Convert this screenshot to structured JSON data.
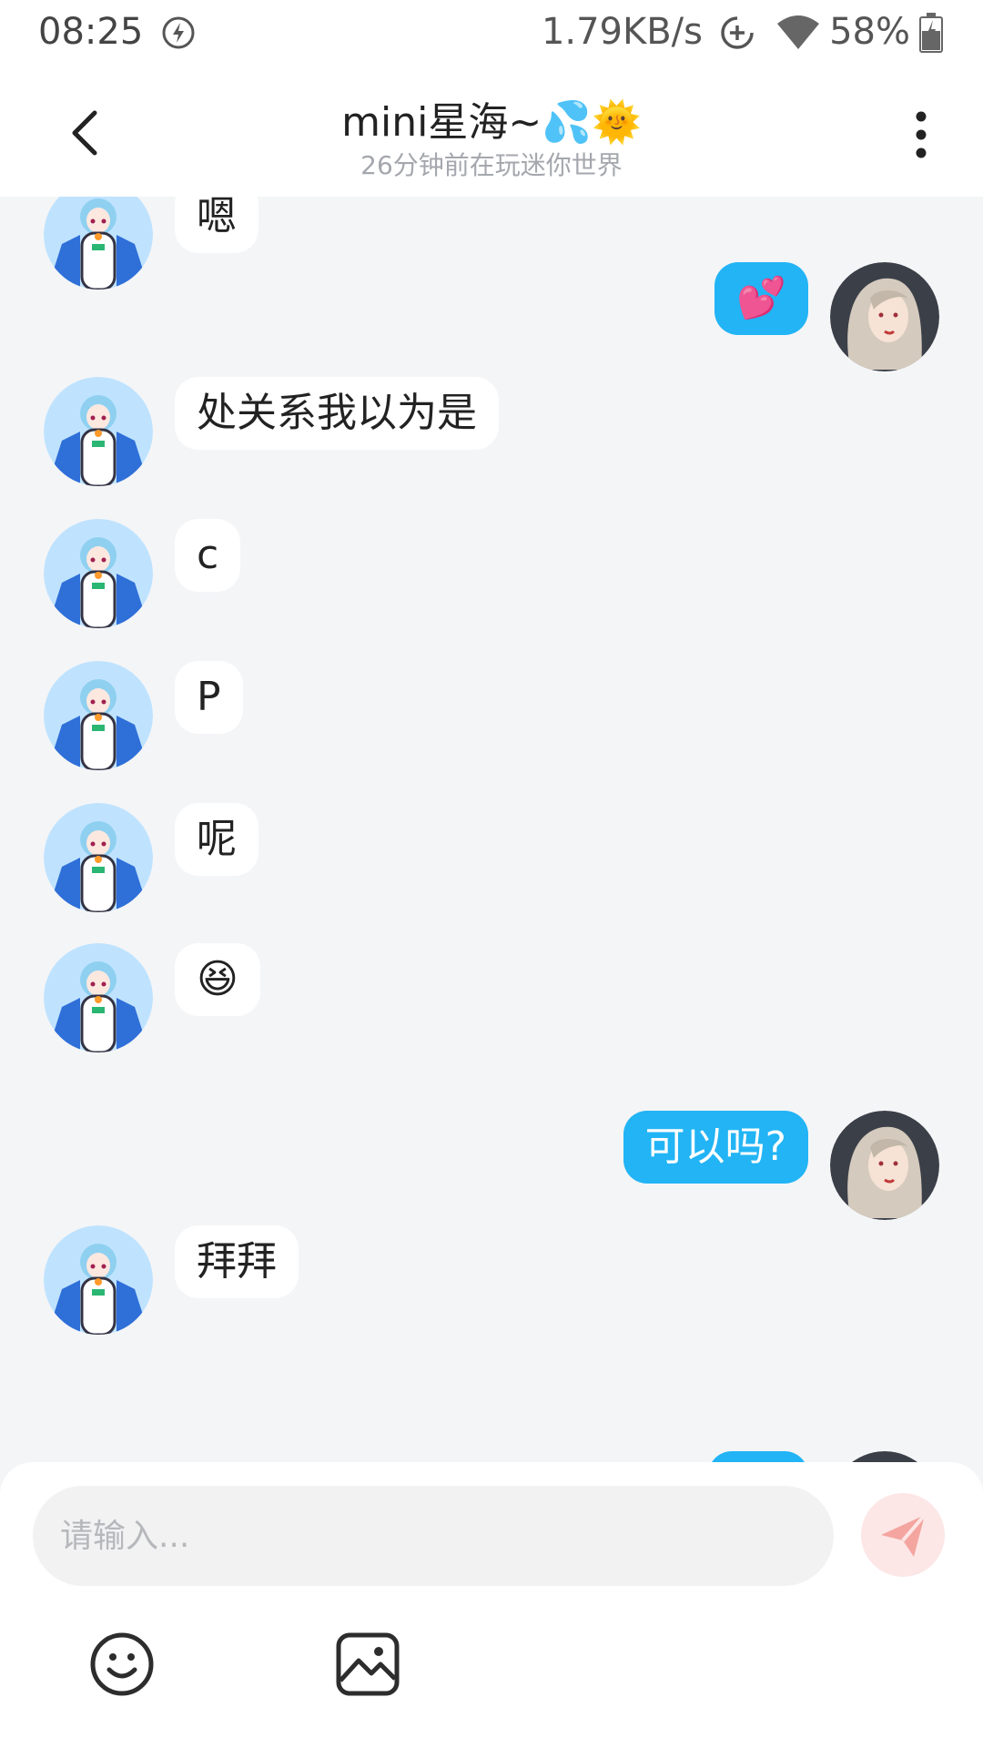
{
  "status_bar": {
    "time": "08:25",
    "network_speed": "1.79KB/s",
    "battery": "58%"
  },
  "header": {
    "title": "mini星海~💦🌞",
    "subtitle": "26分钟前在玩迷你世界"
  },
  "messages": [
    {
      "side": "in",
      "text": "嗯"
    },
    {
      "side": "out",
      "text": "💕"
    },
    {
      "side": "in",
      "text": "处关系我以为是"
    },
    {
      "side": "in",
      "text": "c"
    },
    {
      "side": "in",
      "text": "P"
    },
    {
      "side": "in",
      "text": "呢"
    },
    {
      "side": "in",
      "text": "😆"
    },
    {
      "side": "out",
      "text": "可以吗?"
    },
    {
      "side": "in",
      "text": "拜拜"
    },
    {
      "side": "out",
      "text": ""
    }
  ],
  "input": {
    "placeholder": "请输入..."
  },
  "icons": {
    "back": "chevron-left-icon",
    "more": "more-vertical-icon",
    "send": "send-icon",
    "emoji": "emoji-icon",
    "image": "image-icon"
  },
  "colors": {
    "outgoing_bubble": "#22b4f5",
    "incoming_bubble": "#ffffff",
    "background": "#f4f5f7",
    "send_button_bg": "#fce7e6",
    "send_icon": "#f4a5a0"
  }
}
